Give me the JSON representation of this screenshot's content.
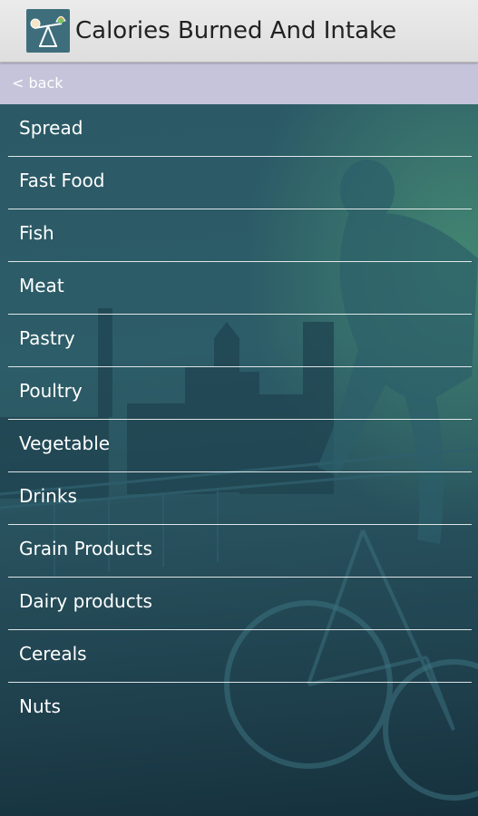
{
  "app": {
    "title": "Calories Burned And Intake",
    "icon": "scale-icon"
  },
  "nav": {
    "back_label": "< back"
  },
  "categories": [
    {
      "label": "Spread"
    },
    {
      "label": "Fast Food"
    },
    {
      "label": "Fish"
    },
    {
      "label": "Meat"
    },
    {
      "label": "Pastry"
    },
    {
      "label": "Poultry"
    },
    {
      "label": "Vegetable"
    },
    {
      "label": "Drinks"
    },
    {
      "label": "Grain Products"
    },
    {
      "label": "Dairy products"
    },
    {
      "label": "Cereals"
    },
    {
      "label": "Nuts"
    }
  ],
  "colors": {
    "action_bar": "#e4e4e4",
    "back_bar": "#c5c4da",
    "list_bg": "#2b5966",
    "text_light": "#ffffff"
  }
}
